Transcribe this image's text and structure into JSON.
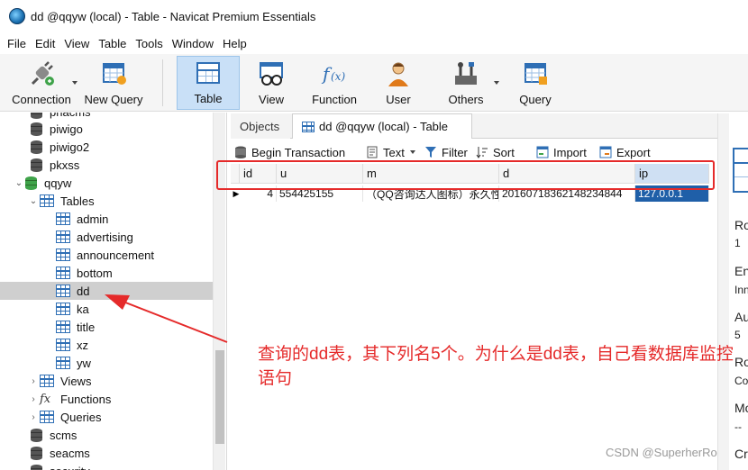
{
  "window": {
    "title": "dd @qqyw (local) - Table - Navicat Premium Essentials"
  },
  "menu": [
    "File",
    "Edit",
    "View",
    "Table",
    "Tools",
    "Window",
    "Help"
  ],
  "toolbar": {
    "connection": "Connection",
    "new_query": "New Query",
    "table": "Table",
    "view": "View",
    "function": "Function",
    "user": "User",
    "others": "Others",
    "query": "Query"
  },
  "sidebar": {
    "top_partial": "phacms",
    "items": [
      {
        "label": "piwigo",
        "kind": "db"
      },
      {
        "label": "piwigo2",
        "kind": "db"
      },
      {
        "label": "pkxss",
        "kind": "db"
      },
      {
        "label": "qqyw",
        "kind": "db-open"
      },
      {
        "label": "Tables",
        "kind": "folder"
      },
      {
        "label": "admin",
        "kind": "table"
      },
      {
        "label": "advertising",
        "kind": "table"
      },
      {
        "label": "announcement",
        "kind": "table"
      },
      {
        "label": "bottom",
        "kind": "table"
      },
      {
        "label": "dd",
        "kind": "table",
        "selected": true
      },
      {
        "label": "ka",
        "kind": "table"
      },
      {
        "label": "title",
        "kind": "table"
      },
      {
        "label": "xz",
        "kind": "table"
      },
      {
        "label": "yw",
        "kind": "table"
      },
      {
        "label": "Views",
        "kind": "folder"
      },
      {
        "label": "Functions",
        "kind": "folder"
      },
      {
        "label": "Queries",
        "kind": "folder"
      },
      {
        "label": "scms",
        "kind": "db"
      },
      {
        "label": "seacms",
        "kind": "db"
      },
      {
        "label": "security",
        "kind": "db"
      }
    ]
  },
  "tabs": {
    "objects": "Objects",
    "current": "dd @qqyw (local) - Table"
  },
  "subtoolbar": {
    "begin_transaction": "Begin Transaction",
    "text": "Text",
    "filter": "Filter",
    "sort": "Sort",
    "import": "Import",
    "export": "Export"
  },
  "grid": {
    "columns": [
      "id",
      "u",
      "m",
      "d",
      "ip"
    ],
    "rows": [
      [
        "4",
        "554425155",
        "（QQ咨询达人图标）永久性",
        "20160718362148234844",
        "127.0.0.1"
      ]
    ]
  },
  "right_panel": {
    "labels": [
      "Ro",
      "1",
      "En",
      "Inn",
      "Au",
      "5",
      "Ro",
      "Co",
      "Mo",
      "--",
      "Cr"
    ]
  },
  "annotation": {
    "text": "查询的dd表，其下列名5个。为什么是dd表，自己看数据库监控语句",
    "color": "#e52a2a"
  },
  "watermark": "CSDN @SuperherRo"
}
